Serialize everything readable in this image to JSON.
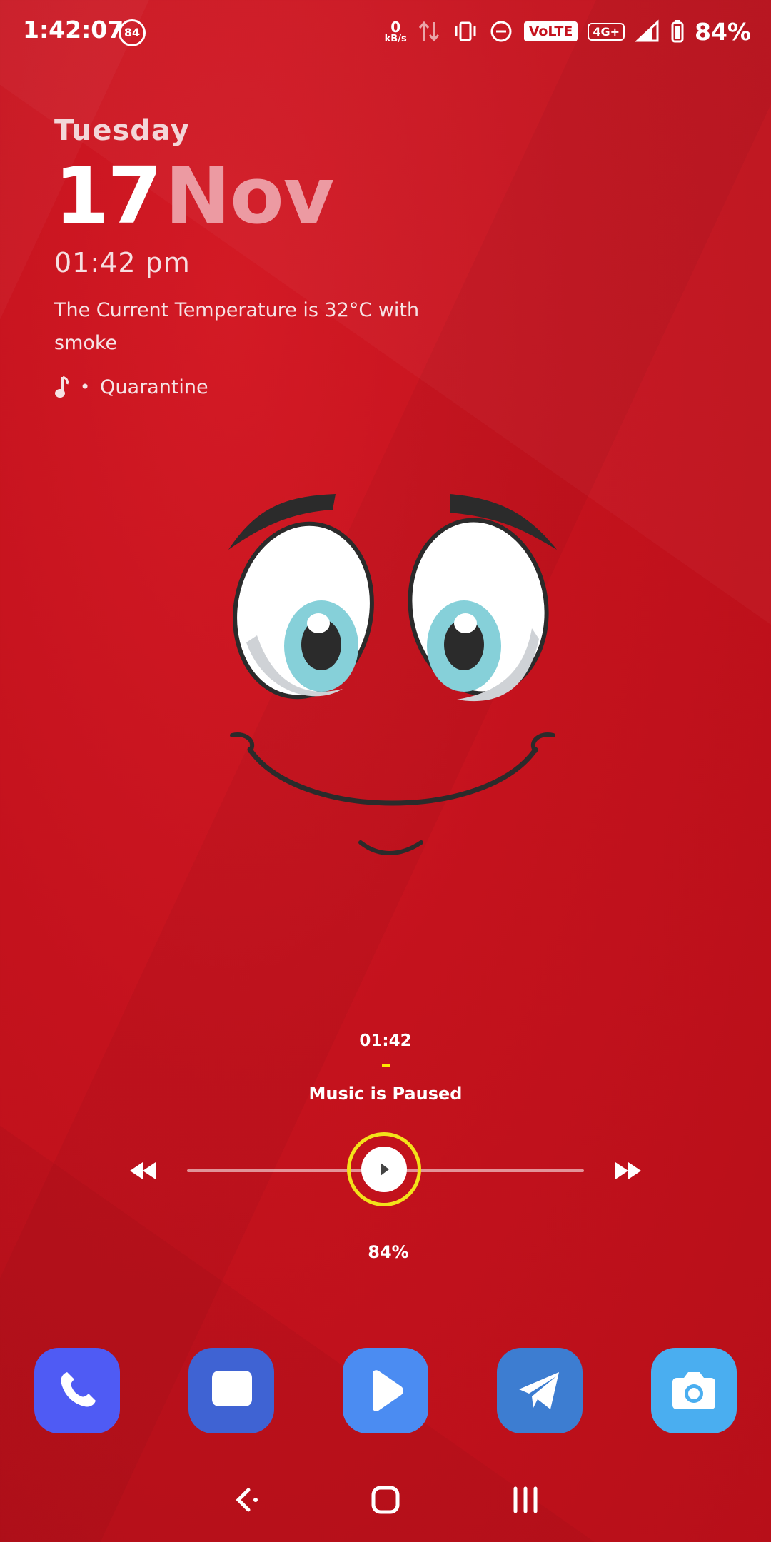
{
  "status_bar": {
    "time": "1:42:07",
    "notification_count": "84",
    "net_speed_value": "0",
    "net_speed_unit": "kB/s",
    "volte_label": "VoLTE",
    "network_label": "4G+",
    "battery_percent": "84%"
  },
  "clock_widget": {
    "day": "Tuesday",
    "date_number": "17",
    "date_month": "Nov",
    "time": "01:42 pm",
    "temperature_text": "The Current Temperature is 32°C with smoke",
    "music_separator": "•",
    "music_title": "Quarantine"
  },
  "music_widget": {
    "clock": "01:42",
    "status": "Music is Paused",
    "battery_percent": "84%"
  },
  "dock": {
    "apps": [
      {
        "name": "Phone",
        "color": "#4f5bf4",
        "icon": "phone-icon"
      },
      {
        "name": "Messages",
        "color": "#3f63d3",
        "icon": "message-icon"
      },
      {
        "name": "Play Store",
        "color": "#4b8cf2",
        "icon": "play-icon"
      },
      {
        "name": "Telegram",
        "color": "#3d7dd1",
        "icon": "send-icon"
      },
      {
        "name": "Camera",
        "color": "#4aaef0",
        "icon": "camera-icon"
      }
    ]
  },
  "colors": {
    "background": "#c4121d",
    "accent_yellow": "#f3e21a",
    "month_pink": "#ec9aa2"
  }
}
